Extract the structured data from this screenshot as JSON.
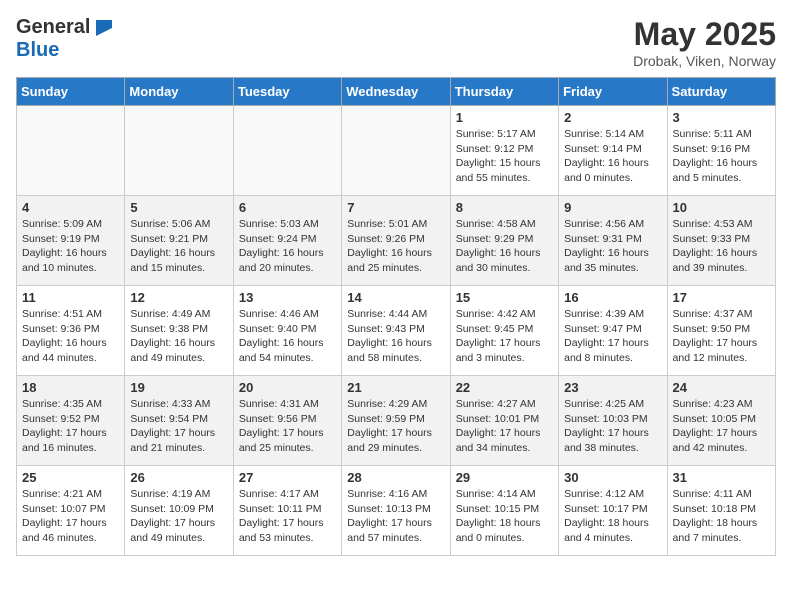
{
  "header": {
    "logo_general": "General",
    "logo_blue": "Blue",
    "month_title": "May 2025",
    "subtitle": "Drobak, Viken, Norway"
  },
  "weekdays": [
    "Sunday",
    "Monday",
    "Tuesday",
    "Wednesday",
    "Thursday",
    "Friday",
    "Saturday"
  ],
  "weeks": [
    [
      {
        "day": "",
        "info": ""
      },
      {
        "day": "",
        "info": ""
      },
      {
        "day": "",
        "info": ""
      },
      {
        "day": "",
        "info": ""
      },
      {
        "day": "1",
        "info": "Sunrise: 5:17 AM\nSunset: 9:12 PM\nDaylight: 15 hours\nand 55 minutes."
      },
      {
        "day": "2",
        "info": "Sunrise: 5:14 AM\nSunset: 9:14 PM\nDaylight: 16 hours\nand 0 minutes."
      },
      {
        "day": "3",
        "info": "Sunrise: 5:11 AM\nSunset: 9:16 PM\nDaylight: 16 hours\nand 5 minutes."
      }
    ],
    [
      {
        "day": "4",
        "info": "Sunrise: 5:09 AM\nSunset: 9:19 PM\nDaylight: 16 hours\nand 10 minutes."
      },
      {
        "day": "5",
        "info": "Sunrise: 5:06 AM\nSunset: 9:21 PM\nDaylight: 16 hours\nand 15 minutes."
      },
      {
        "day": "6",
        "info": "Sunrise: 5:03 AM\nSunset: 9:24 PM\nDaylight: 16 hours\nand 20 minutes."
      },
      {
        "day": "7",
        "info": "Sunrise: 5:01 AM\nSunset: 9:26 PM\nDaylight: 16 hours\nand 25 minutes."
      },
      {
        "day": "8",
        "info": "Sunrise: 4:58 AM\nSunset: 9:29 PM\nDaylight: 16 hours\nand 30 minutes."
      },
      {
        "day": "9",
        "info": "Sunrise: 4:56 AM\nSunset: 9:31 PM\nDaylight: 16 hours\nand 35 minutes."
      },
      {
        "day": "10",
        "info": "Sunrise: 4:53 AM\nSunset: 9:33 PM\nDaylight: 16 hours\nand 39 minutes."
      }
    ],
    [
      {
        "day": "11",
        "info": "Sunrise: 4:51 AM\nSunset: 9:36 PM\nDaylight: 16 hours\nand 44 minutes."
      },
      {
        "day": "12",
        "info": "Sunrise: 4:49 AM\nSunset: 9:38 PM\nDaylight: 16 hours\nand 49 minutes."
      },
      {
        "day": "13",
        "info": "Sunrise: 4:46 AM\nSunset: 9:40 PM\nDaylight: 16 hours\nand 54 minutes."
      },
      {
        "day": "14",
        "info": "Sunrise: 4:44 AM\nSunset: 9:43 PM\nDaylight: 16 hours\nand 58 minutes."
      },
      {
        "day": "15",
        "info": "Sunrise: 4:42 AM\nSunset: 9:45 PM\nDaylight: 17 hours\nand 3 minutes."
      },
      {
        "day": "16",
        "info": "Sunrise: 4:39 AM\nSunset: 9:47 PM\nDaylight: 17 hours\nand 8 minutes."
      },
      {
        "day": "17",
        "info": "Sunrise: 4:37 AM\nSunset: 9:50 PM\nDaylight: 17 hours\nand 12 minutes."
      }
    ],
    [
      {
        "day": "18",
        "info": "Sunrise: 4:35 AM\nSunset: 9:52 PM\nDaylight: 17 hours\nand 16 minutes."
      },
      {
        "day": "19",
        "info": "Sunrise: 4:33 AM\nSunset: 9:54 PM\nDaylight: 17 hours\nand 21 minutes."
      },
      {
        "day": "20",
        "info": "Sunrise: 4:31 AM\nSunset: 9:56 PM\nDaylight: 17 hours\nand 25 minutes."
      },
      {
        "day": "21",
        "info": "Sunrise: 4:29 AM\nSunset: 9:59 PM\nDaylight: 17 hours\nand 29 minutes."
      },
      {
        "day": "22",
        "info": "Sunrise: 4:27 AM\nSunset: 10:01 PM\nDaylight: 17 hours\nand 34 minutes."
      },
      {
        "day": "23",
        "info": "Sunrise: 4:25 AM\nSunset: 10:03 PM\nDaylight: 17 hours\nand 38 minutes."
      },
      {
        "day": "24",
        "info": "Sunrise: 4:23 AM\nSunset: 10:05 PM\nDaylight: 17 hours\nand 42 minutes."
      }
    ],
    [
      {
        "day": "25",
        "info": "Sunrise: 4:21 AM\nSunset: 10:07 PM\nDaylight: 17 hours\nand 46 minutes."
      },
      {
        "day": "26",
        "info": "Sunrise: 4:19 AM\nSunset: 10:09 PM\nDaylight: 17 hours\nand 49 minutes."
      },
      {
        "day": "27",
        "info": "Sunrise: 4:17 AM\nSunset: 10:11 PM\nDaylight: 17 hours\nand 53 minutes."
      },
      {
        "day": "28",
        "info": "Sunrise: 4:16 AM\nSunset: 10:13 PM\nDaylight: 17 hours\nand 57 minutes."
      },
      {
        "day": "29",
        "info": "Sunrise: 4:14 AM\nSunset: 10:15 PM\nDaylight: 18 hours\nand 0 minutes."
      },
      {
        "day": "30",
        "info": "Sunrise: 4:12 AM\nSunset: 10:17 PM\nDaylight: 18 hours\nand 4 minutes."
      },
      {
        "day": "31",
        "info": "Sunrise: 4:11 AM\nSunset: 10:18 PM\nDaylight: 18 hours\nand 7 minutes."
      }
    ]
  ]
}
